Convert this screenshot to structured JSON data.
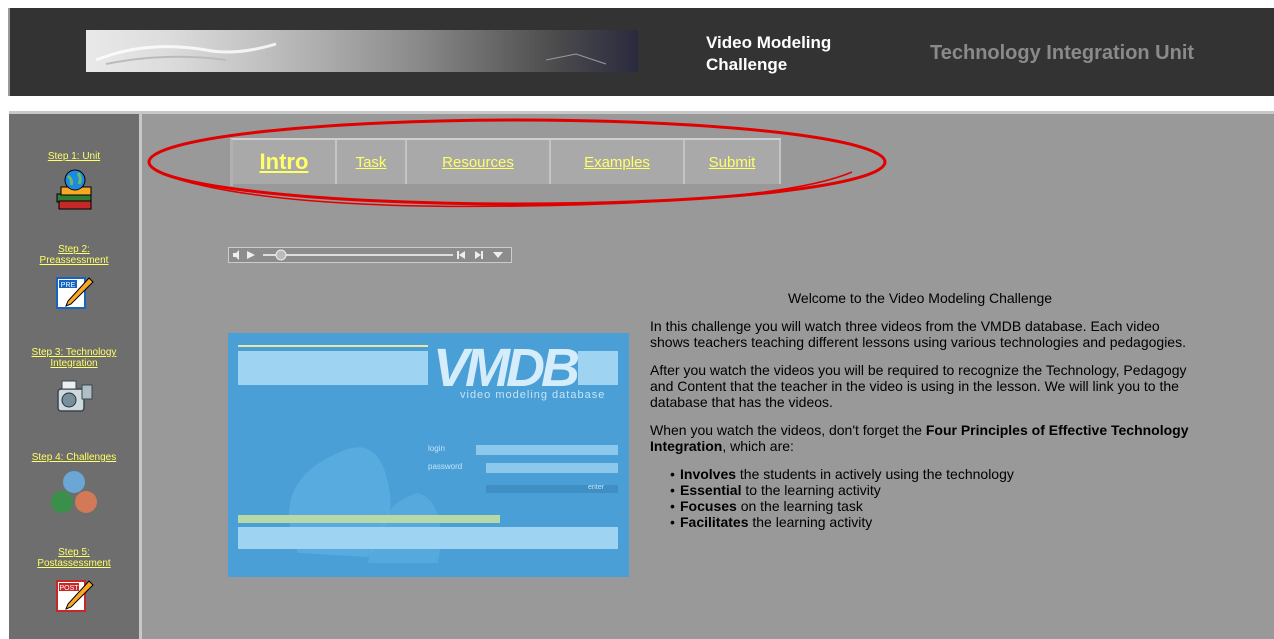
{
  "header": {
    "title_line1": "Video Modeling",
    "title_line2": "Challenge",
    "unit_title": "Technology Integration Unit"
  },
  "sidebar": {
    "steps": [
      {
        "label_line1": "Step 1: Unit",
        "label_line2": "",
        "icon": "books-globe-icon"
      },
      {
        "label_line1": "Step 2:",
        "label_line2": "Preassessment",
        "icon": "pre-pencil-icon"
      },
      {
        "label_line1": "Step 3: Technology",
        "label_line2": "Integration",
        "icon": "camcorder-icon"
      },
      {
        "label_line1": "Step 4: Challenges",
        "label_line2": "",
        "icon": "challenges-circles-icon"
      },
      {
        "label_line1": "Step 5:",
        "label_line2": "Postassessment",
        "icon": "post-pencil-icon"
      }
    ]
  },
  "tabs": [
    {
      "label": "Intro",
      "active": true
    },
    {
      "label": "Task",
      "active": false
    },
    {
      "label": "Resources",
      "active": false
    },
    {
      "label": "Examples",
      "active": false
    },
    {
      "label": "Submit",
      "active": false
    }
  ],
  "vmdb": {
    "logo": "VMDB",
    "tagline": "video modeling database",
    "login_label": "login",
    "password_label": "password",
    "enter_label": "enter"
  },
  "content": {
    "welcome": "Welcome to the Video Modeling Challenge",
    "para1": "In this challenge you will watch three videos from the VMDB database. Each video shows teachers teaching different lessons using various technologies and pedagogies.",
    "para2": "After you watch the videos you will be required to recognize the Technology, Pedagogy and Content that the teacher in the video is using in the lesson. We will link you to the database that has the videos.",
    "para3_start": "When you watch the videos, don't forget the ",
    "para3_bold": "Four Principles of Effective Technology Integration",
    "para3_end": ", which are:",
    "principles": [
      {
        "bold": "Involves",
        "rest": " the students in actively using the technology"
      },
      {
        "bold": "Essential",
        "rest": " to the learning activity"
      },
      {
        "bold": "Focuses",
        "rest": " on the learning task"
      },
      {
        "bold": "Facilitates",
        "rest": " the learning activity"
      }
    ]
  },
  "colors": {
    "header_bg": "#333333",
    "sidebar_bg": "#6e6e6e",
    "content_bg": "#999999",
    "link_yellow": "#ffff66",
    "highlight_oval": "#e00000",
    "vmdb_blue": "#4a9fd6"
  }
}
